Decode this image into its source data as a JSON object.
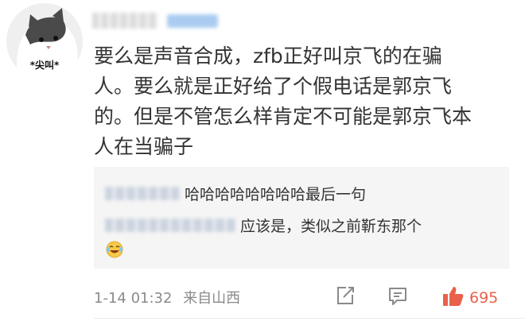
{
  "avatar": {
    "caption": "*尖叫*"
  },
  "post": {
    "text": "要么是声音合成，zfb正好叫京飞的在骗\n人。要么就是正好给了个假电话是郭京飞\n的。但是不管怎么样肯定不可能是郭京飞本\n人在当骗子"
  },
  "replies": [
    {
      "text": "哈哈哈哈哈哈哈哈最后一句"
    },
    {
      "text": "应该是，类似之前靳东那个"
    }
  ],
  "footer": {
    "date": "1-14 01:32",
    "location": "来自山西",
    "like_count": "695"
  },
  "colors": {
    "like": "#e8614a",
    "meta": "#8a8a8a",
    "reply_bg": "#f5f5f5"
  },
  "icons": {
    "share": "share-icon",
    "comment": "comment-icon",
    "like": "thumbs-up-icon",
    "emoji": "laughing-emoji-icon"
  }
}
